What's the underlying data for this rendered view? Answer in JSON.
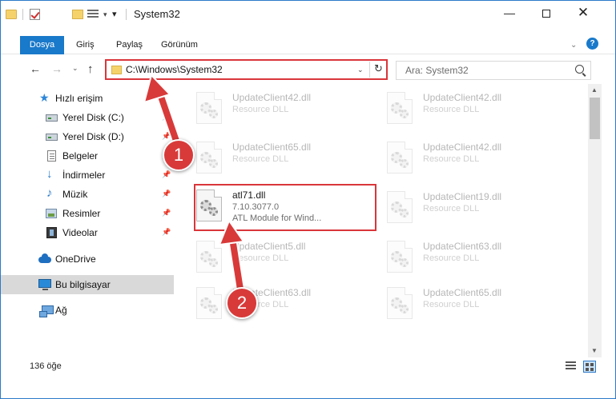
{
  "window": {
    "title": "System32",
    "minimize_glyph": "—",
    "close_glyph": "✕"
  },
  "ribbon": {
    "tabs": [
      {
        "label": "Dosya"
      },
      {
        "label": "Giriş"
      },
      {
        "label": "Paylaş"
      },
      {
        "label": "Görünüm"
      }
    ],
    "help_glyph": "?",
    "collapse_glyph": "⌄"
  },
  "nav": {
    "back_glyph": "←",
    "forward_glyph": "→",
    "recent_glyph": "⌄",
    "up_glyph": "↑",
    "address": "C:\\Windows\\System32",
    "address_dropdown_glyph": "⌄",
    "refresh_glyph": "↻",
    "search_placeholder": "Ara: System32"
  },
  "sidebar": {
    "items": [
      {
        "label": "Hızlı erişim",
        "icon": "star-icon"
      },
      {
        "label": "Yerel Disk (C:)",
        "icon": "drive-icon",
        "pinned": true
      },
      {
        "label": "Yerel Disk (D:)",
        "icon": "drive-icon",
        "pinned": true
      },
      {
        "label": "Belgeler",
        "icon": "document-icon",
        "pinned": true
      },
      {
        "label": "İndirmeler",
        "icon": "download-icon",
        "pinned": true
      },
      {
        "label": "Müzik",
        "icon": "music-icon",
        "pinned": true
      },
      {
        "label": "Resimler",
        "icon": "pictures-icon",
        "pinned": true
      },
      {
        "label": "Videolar",
        "icon": "videos-icon",
        "pinned": true
      },
      {
        "label": "OneDrive",
        "icon": "cloud-icon"
      },
      {
        "label": "Bu bilgisayar",
        "icon": "computer-icon",
        "selected": true
      },
      {
        "label": "Ağ",
        "icon": "network-icon"
      }
    ],
    "pin_glyph": "📌"
  },
  "files": [
    {
      "name": "UpdateClient42.dll",
      "type": "Resource DLL"
    },
    {
      "name": "UpdateClient42.dll",
      "type": "Resource DLL"
    },
    {
      "name": "UpdateClient65.dll",
      "type": "Resource DLL"
    },
    {
      "name": "UpdateClient42.dll",
      "type": "Resource DLL"
    },
    {
      "name": "atl71.dll",
      "version": "7.10.3077.0",
      "description": "ATL Module for Wind..."
    },
    {
      "name": "UpdateClient19.dll",
      "type": "Resource DLL"
    },
    {
      "name": "UpdateClient5.dll",
      "type": "Resource DLL"
    },
    {
      "name": "UpdateClient63.dll",
      "type": "Resource DLL"
    },
    {
      "name": "UpdateClient63.dll",
      "type": "Resource DLL"
    },
    {
      "name": "UpdateClient65.dll",
      "type": "Resource DLL"
    }
  ],
  "status": {
    "count": "136 öğe"
  },
  "annotations": {
    "badge1": "1",
    "badge2": "2"
  },
  "colors": {
    "accent": "#1979ca",
    "annotation_red": "#d83a3a",
    "selection": "#d9d9d9"
  }
}
